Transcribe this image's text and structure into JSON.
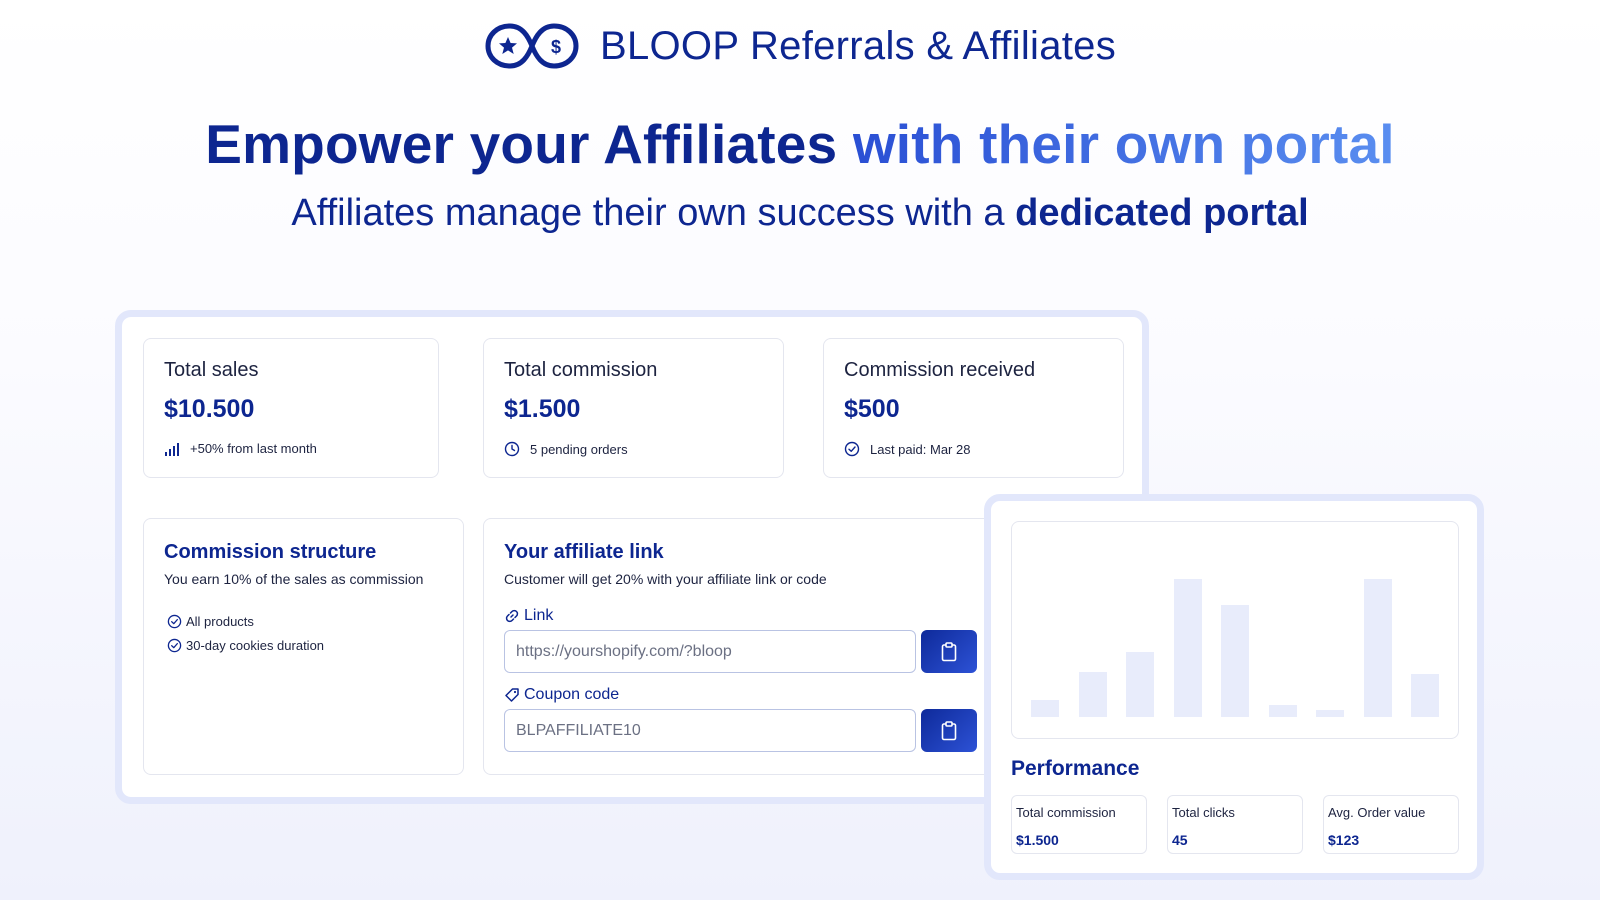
{
  "brand": {
    "name": "BLOOP Referrals & Affiliates",
    "logo_icon": "infinity-star-dollar-icon"
  },
  "hero": {
    "title_part1": "Empower your",
    "title_part2": "Affiliates",
    "title_part3": "with their own portal",
    "subtitle_part1": "Affiliates manage their own success with a",
    "subtitle_bold": "dedicated portal"
  },
  "stats": [
    {
      "label": "Total sales",
      "value": "$10.500",
      "meta": "+50% from last month",
      "icon": "bar-chart-icon"
    },
    {
      "label": "Total commission",
      "value": "$1.500",
      "meta": "5 pending orders",
      "icon": "clock-icon"
    },
    {
      "label": "Commission received",
      "value": "$500",
      "meta": "Last paid: Mar 28",
      "icon": "check-circle-icon"
    }
  ],
  "commission": {
    "title": "Commission structure",
    "desc": "You earn 10% of the sales as commission",
    "items": [
      "All products",
      "30-day cookies duration"
    ]
  },
  "affiliate": {
    "title": "Your affiliate link",
    "desc": "Customer will get 20% with your affiliate link or code",
    "link_label": "Link",
    "link_value": "https://yourshopify.com/?bloop",
    "coupon_label": "Coupon code",
    "coupon_value": "BLPAFFILIATE10"
  },
  "performance": {
    "title": "Performance",
    "cards": [
      {
        "label": "Total commission",
        "value": "$1.500"
      },
      {
        "label": "Total clicks",
        "value": "45"
      },
      {
        "label": "Avg. Order value",
        "value": "$123"
      }
    ]
  },
  "chart_data": {
    "type": "bar",
    "values": [
      10,
      26,
      38,
      80,
      65,
      7,
      4,
      80,
      25
    ],
    "ylim": [
      0,
      100
    ],
    "grid": false,
    "bar_color": "#e8ecfb"
  },
  "colors": {
    "brand": "#0d2690",
    "accent_start": "#2a4fd4",
    "accent_end": "#5a8ef0",
    "button": "#0e2a9a"
  }
}
